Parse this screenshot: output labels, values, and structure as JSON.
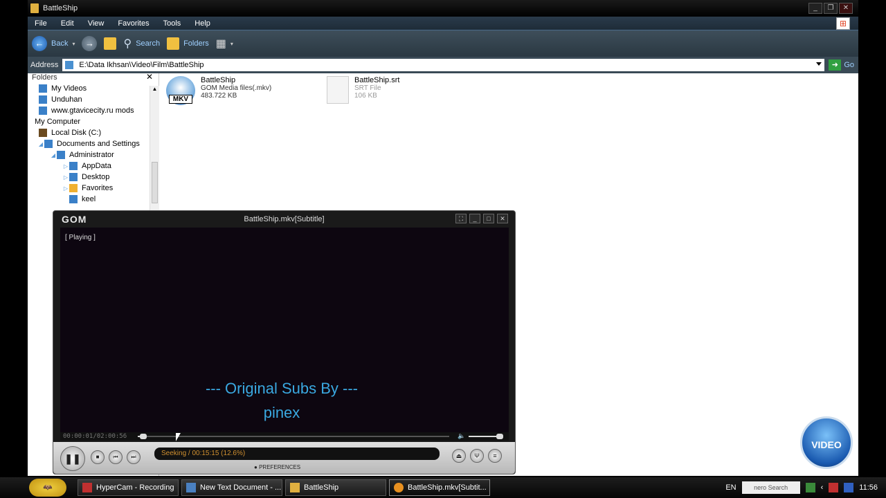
{
  "explorer": {
    "title": "BattleShip",
    "menu": [
      "File",
      "Edit",
      "View",
      "Favorites",
      "Tools",
      "Help"
    ],
    "toolbar": {
      "back": "Back",
      "search": "Search",
      "folders": "Folders"
    },
    "address_label": "Address",
    "address_value": "E:\\Data Ikhsan\\Video\\Film\\BattleShip",
    "go_label": "Go",
    "folders_header": "Folders",
    "tree": [
      {
        "label": "My Videos",
        "indent": 1,
        "expander": ""
      },
      {
        "label": "Unduhan",
        "indent": 1,
        "expander": ""
      },
      {
        "label": "www.gtavicecity.ru mods",
        "indent": 1,
        "expander": ""
      },
      {
        "label": "My Computer",
        "indent": 0,
        "expander": ""
      },
      {
        "label": "Local Disk (C:)",
        "indent": 1,
        "expander": ""
      },
      {
        "label": "Documents and Settings",
        "indent": 2,
        "expander": "◢"
      },
      {
        "label": "Administrator",
        "indent": 3,
        "expander": "◢"
      },
      {
        "label": "AppData",
        "indent": 4,
        "expander": "▷"
      },
      {
        "label": "Desktop",
        "indent": 4,
        "expander": "▷"
      },
      {
        "label": "Favorites",
        "indent": 4,
        "expander": "▷"
      },
      {
        "label": "keel",
        "indent": 4,
        "expander": ""
      }
    ],
    "files": [
      {
        "name": "BattleShip",
        "type": "GOM Media files(.mkv)",
        "size": "483.722 KB",
        "icon_label": "MKV"
      },
      {
        "name": "BattleShip.srt",
        "type": "SRT File",
        "size": "106 KB"
      }
    ]
  },
  "gom": {
    "caption": "BattleShip.mkv[Subtitle]",
    "logo": "GOM",
    "state": "[ Playing ]",
    "subtitle_line1": "--- Original Subs By ---",
    "subtitle_line2": "pinex",
    "time": "00:00:01/02:00:56",
    "seek_progress": 0.01,
    "volume_level": 1.0,
    "status": "Seeking / 00:15:15 (12.6%)",
    "preferences": "PREFERENCES"
  },
  "badge": "VIDEO",
  "taskbar": {
    "tasks": [
      {
        "label": "HyperCam - Recording"
      },
      {
        "label": "New Text Document - ..."
      },
      {
        "label": "BattleShip"
      },
      {
        "label": "BattleShip.mkv[Subtit..."
      }
    ],
    "lang": "EN",
    "nero": "nero Search",
    "clock": "11:56"
  }
}
